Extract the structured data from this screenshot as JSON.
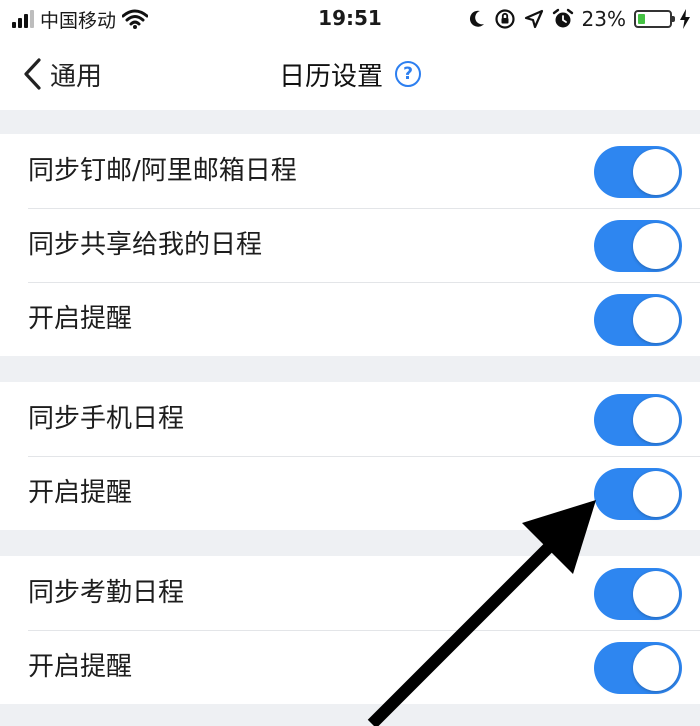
{
  "status_bar": {
    "carrier": "中国移动",
    "time": "19:51",
    "battery_percent": "23%",
    "battery_level": 0.23,
    "icons": [
      "signal-icon",
      "wifi-icon",
      "moon-icon",
      "rotation-lock-icon",
      "location-icon",
      "alarm-icon",
      "battery-icon",
      "charging-icon"
    ]
  },
  "nav": {
    "back_label": "通用",
    "title": "日历设置",
    "help_symbol": "?"
  },
  "groups": [
    {
      "rows": [
        {
          "label": "同步钉邮/阿里邮箱日程",
          "enabled": true
        },
        {
          "label": "同步共享给我的日程",
          "enabled": true
        },
        {
          "label": "开启提醒",
          "enabled": true
        }
      ]
    },
    {
      "rows": [
        {
          "label": "同步手机日程",
          "enabled": true
        },
        {
          "label": "开启提醒",
          "enabled": true
        }
      ]
    },
    {
      "rows": [
        {
          "label": "同步考勤日程",
          "enabled": true
        },
        {
          "label": "开启提醒",
          "enabled": true
        }
      ]
    }
  ],
  "colors": {
    "accent": "#2e86f0",
    "help": "#2d7ff0",
    "background": "#eef0f3",
    "battery_fill": "#44c243"
  }
}
